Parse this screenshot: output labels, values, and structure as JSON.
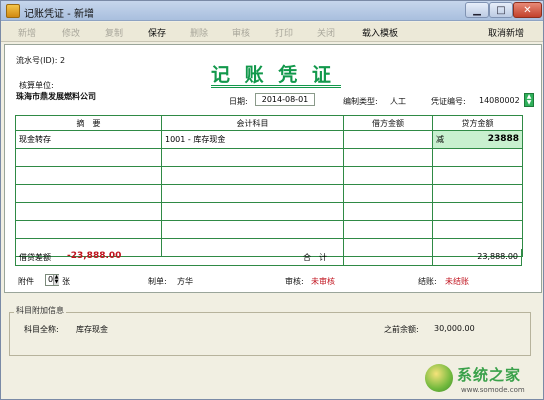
{
  "window": {
    "title": "记账凭证 - 新增",
    "min_glyph": "▁",
    "max_glyph": "□",
    "close_glyph": "✕"
  },
  "toolbar": {
    "items": [
      {
        "label": "新增",
        "enabled": false
      },
      {
        "label": "修改",
        "enabled": false
      },
      {
        "label": "复制",
        "enabled": false
      },
      {
        "label": "保存",
        "enabled": true
      },
      {
        "label": "删除",
        "enabled": false
      },
      {
        "label": "审核",
        "enabled": false
      },
      {
        "label": "打印",
        "enabled": false
      },
      {
        "label": "关闭",
        "enabled": false
      },
      {
        "label": "载入模板",
        "enabled": true
      },
      {
        "label": "取消新增",
        "enabled": true
      }
    ]
  },
  "header": {
    "serial_label": "流水号(ID): 2",
    "unit_label": "核算单位:",
    "unit_name": "珠海市鼎发展燃料公司",
    "title": "记 账 凭 证",
    "date_label": "日期:",
    "date_value": "2014-08-01",
    "maker_type_label": "编制类型:",
    "maker_type_value": "人工",
    "voucher_no_label": "凭证编号:",
    "voucher_no_value": "14080002",
    "spin_up": "▲",
    "spin_down": "▼"
  },
  "table": {
    "columns": [
      "摘　要",
      "会计科目",
      "借方金额",
      "贷方金额"
    ],
    "rows": [
      {
        "summary": "现金转存",
        "account": "1001 - 库存现金",
        "debit": "",
        "credit_dir": "减",
        "credit": "23888"
      },
      {
        "summary": "",
        "account": "",
        "debit": "",
        "credit_dir": "",
        "credit": ""
      },
      {
        "summary": "",
        "account": "",
        "debit": "",
        "credit_dir": "",
        "credit": ""
      },
      {
        "summary": "",
        "account": "",
        "debit": "",
        "credit_dir": "",
        "credit": ""
      },
      {
        "summary": "",
        "account": "",
        "debit": "",
        "credit_dir": "",
        "credit": ""
      },
      {
        "summary": "",
        "account": "",
        "debit": "",
        "credit_dir": "",
        "credit": ""
      },
      {
        "summary": "",
        "account": "",
        "debit": "",
        "credit_dir": "",
        "credit": ""
      }
    ],
    "diff_label": "借贷差额",
    "diff_value": "-23,888.00",
    "total_label": "合　计",
    "total_value": "23,888.00"
  },
  "footer": {
    "attach_label": "附件",
    "attach_value": "0",
    "attach_unit": "张",
    "spin_up": "▲",
    "spin_down": "▼",
    "maker_label": "制单:",
    "maker_value": "方华",
    "audit_label": "审核:",
    "audit_value": "未审核",
    "post_label": "结账:",
    "post_value": "未结账"
  },
  "info": {
    "legend": "科目附加信息",
    "account_full_label": "科目全称:",
    "account_full_value": "库存现金",
    "prev_balance_label": "之前余额:",
    "prev_balance_value": "30,000.00"
  },
  "watermark": {
    "text": "系统之家",
    "url": "www.somode.com"
  },
  "colors": {
    "title_green": "#12984b",
    "grid_green": "#2f8a45",
    "credit_cell": "#c8f0cf",
    "alert_red": "#c0121d"
  }
}
